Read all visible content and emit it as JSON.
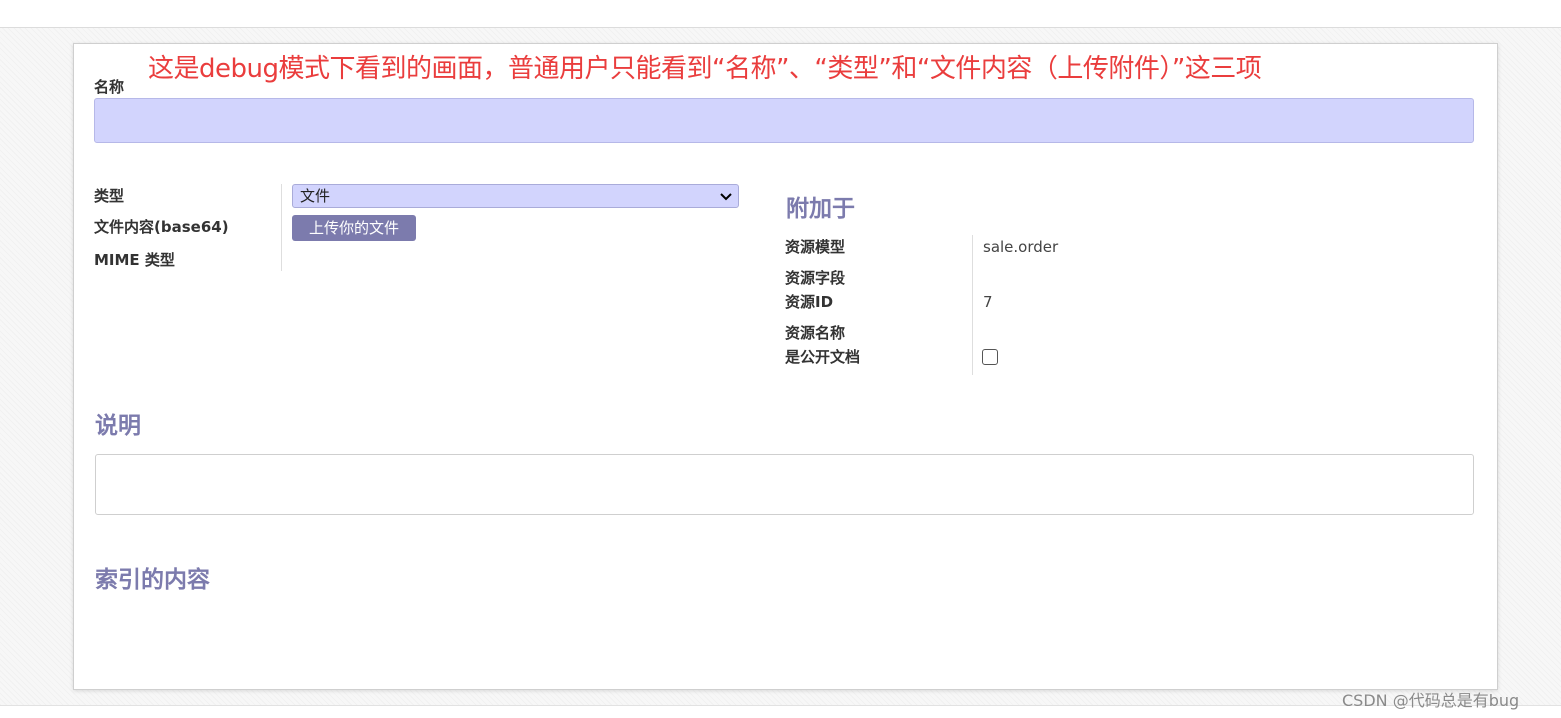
{
  "annotation": "这是debug模式下看到的画面，普通用户只能看到“名称”、“类型”和“文件内容（上传附件）”这三项",
  "form": {
    "name_label": "名称",
    "name_value": "",
    "type_label": "类型",
    "type_value": "文件",
    "file_content_label": "文件内容(base64)",
    "upload_button": "上传你的文件",
    "mime_label": "MIME 类型"
  },
  "attached": {
    "title": "附加于",
    "res_model_label": "资源模型",
    "res_model_value": "sale.order",
    "res_field_label": "资源字段",
    "res_id_label": "资源ID",
    "res_id_value": "7",
    "res_name_label": "资源名称",
    "public_label": "是公开文档",
    "public_checked": false
  },
  "description": {
    "title": "说明",
    "value": ""
  },
  "indexed": {
    "title": "索引的内容"
  },
  "watermark": "CSDN @代码总是有bug",
  "colors": {
    "accent": "#7c7bad",
    "input_bg": "#d2d4fd",
    "annotation": "#ea3d3d"
  }
}
